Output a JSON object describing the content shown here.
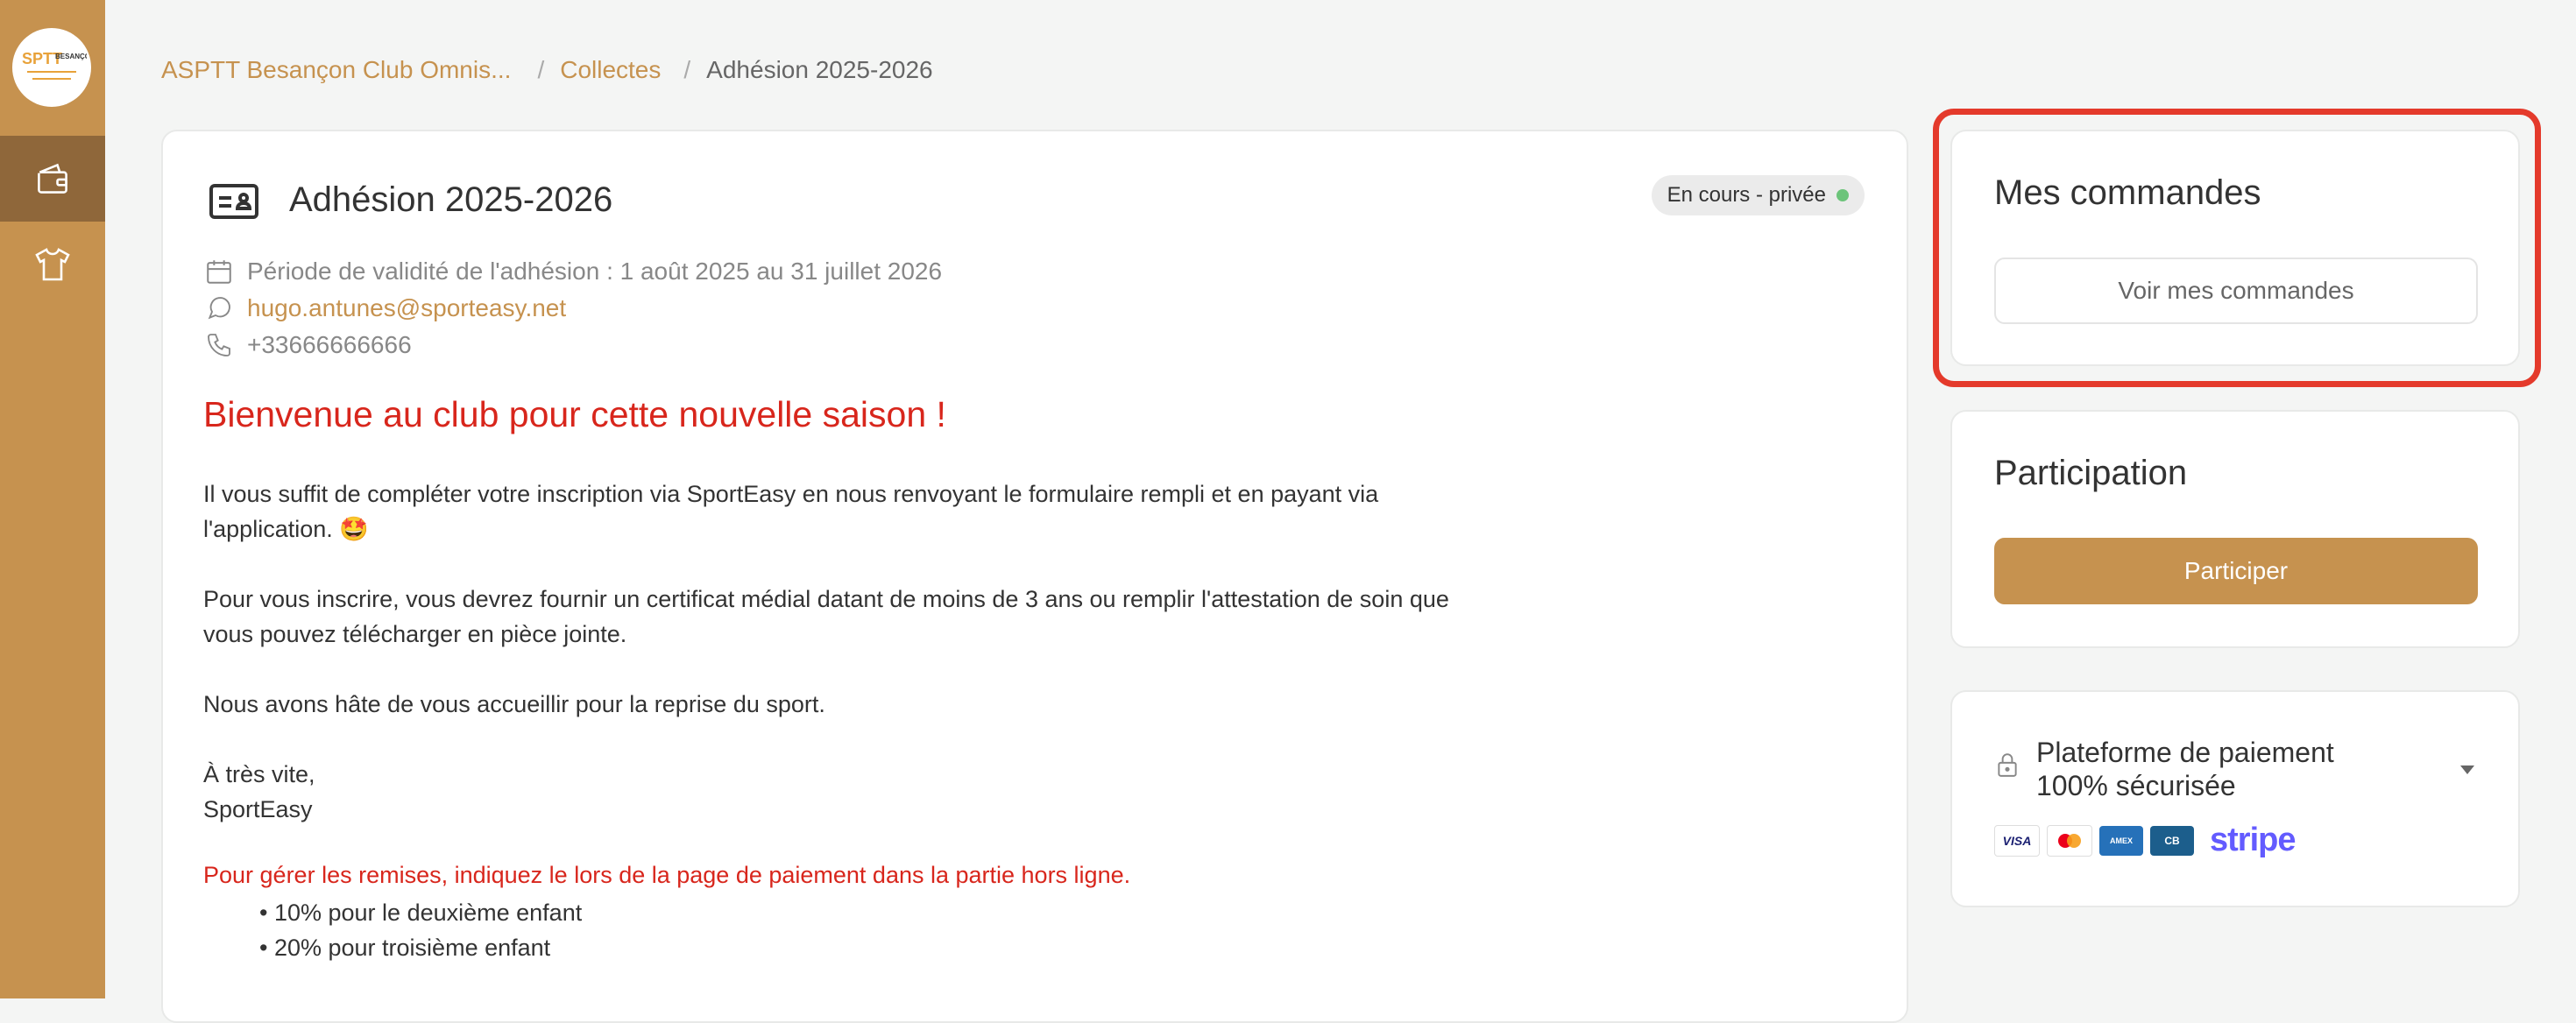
{
  "sidebar": {
    "logo_text": "BESANÇO",
    "items": [
      {
        "icon": "wallet-icon",
        "active": true
      },
      {
        "icon": "shirt-icon",
        "active": false
      }
    ]
  },
  "breadcrumb": {
    "club": "ASPTT Besançon Club Omnis...",
    "sep": "/",
    "collectes": "Collectes",
    "current": "Adhésion 2025-2026"
  },
  "main": {
    "title": "Adhésion 2025-2026",
    "status": "En cours - privée",
    "validity": "Période de validité de l'adhésion : 1 août 2025 au 31 juillet 2026",
    "email": "hugo.antunes@sporteasy.net",
    "phone": "+33666666666",
    "welcome": "Bienvenue au club pour cette nouvelle saison !",
    "para1_line1": "Il vous suffit de compléter votre inscription via SportEasy en nous renvoyant le formulaire rempli et en payant via",
    "para1_line2": "l'application. 🤩",
    "para2_line1": "Pour vous inscrire, vous devrez fournir un certificat médial datant de moins de 3 ans ou remplir l'attestation de soin que",
    "para2_line2": "vous pouvez télécharger en pièce jointe.",
    "para3": "Nous avons hâte de vous accueillir pour la reprise du sport.",
    "closing1": "À très vite,",
    "closing2": "SportEasy",
    "discount_note": "Pour gérer les remises, indiquez le lors de la page de paiement dans la partie hors ligne.",
    "discounts": [
      "10% pour le deuxième enfant",
      "20% pour troisième enfant"
    ]
  },
  "orders": {
    "title": "Mes commandes",
    "button": "Voir mes commandes"
  },
  "participation": {
    "title": "Participation",
    "button": "Participer"
  },
  "payment": {
    "title_line1": "Plateforme de paiement",
    "title_line2": "100% sécurisée",
    "logos": [
      "VISA",
      "mastercard",
      "AMERICAN EXPRESS",
      "CB",
      "stripe"
    ]
  },
  "colors": {
    "brand": "#c6924f",
    "sidebar_active": "#8f673a",
    "highlight": "#e43a2b",
    "welcome_red": "#d8261c",
    "status_dot": "#6cc47a",
    "stripe": "#635bff"
  }
}
